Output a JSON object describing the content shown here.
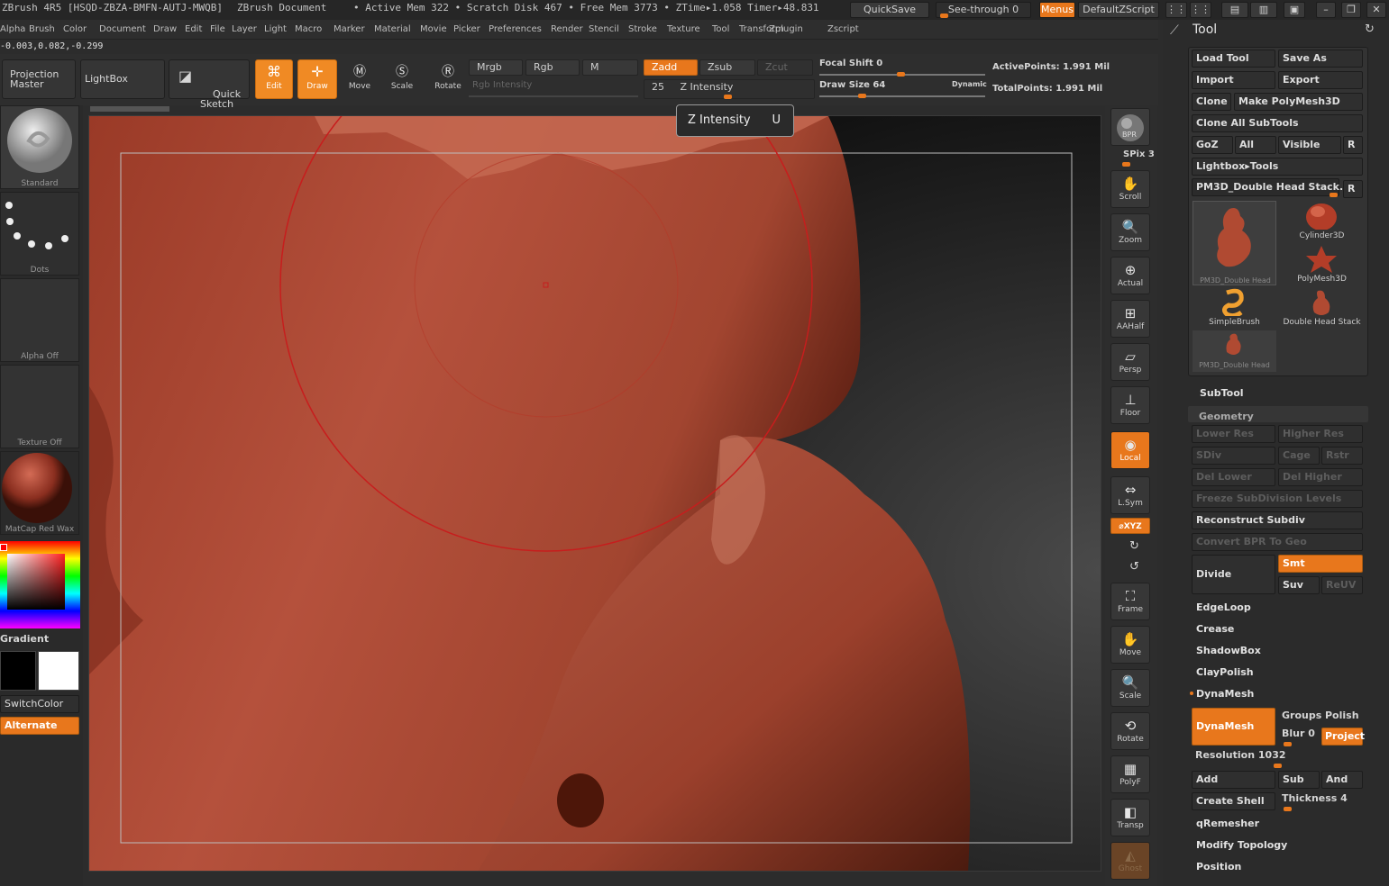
{
  "titlebar": {
    "app": "ZBrush 4R5 [HSQD-ZBZA-BMFN-AUTJ-MWQB]",
    "doc": "ZBrush Document",
    "stats": "• Active Mem 322 • Scratch Disk 467 • Free Mem 3773 • ZTime▸1.058 Timer▸48.831",
    "quicksave": "QuickSave",
    "seethrough": "See-through  0",
    "menus": "Menus",
    "script": "DefaultZScript"
  },
  "menubar": [
    "Alpha",
    "Brush",
    "Color",
    "Document",
    "Draw",
    "Edit",
    "File",
    "Layer",
    "Light",
    "Macro",
    "Marker",
    "Material",
    "Movie",
    "Picker",
    "Preferences",
    "Render",
    "Stencil",
    "Stroke",
    "Texture",
    "Tool",
    "Transform",
    "Zplugin",
    "Zscript"
  ],
  "coords": "-0.003,0.082,-0.299",
  "toolbar": {
    "projection_master": "Projection\nMaster",
    "lightbox": "LightBox",
    "quick_sketch": "Quick\nSketch",
    "edit": "Edit",
    "draw": "Draw",
    "move": "Move",
    "scale": "Scale",
    "rotate": "Rotate",
    "mrgb": "Mrgb",
    "rgb": "Rgb",
    "m": "M",
    "rgb_intensity": "Rgb Intensity",
    "zadd": "Zadd",
    "zsub": "Zsub",
    "zcut": "Zcut",
    "z_intensity_value": "25",
    "z_intensity": "Z Intensity",
    "focal_shift": "Focal Shift 0",
    "draw_size": "Draw Size 64",
    "dynamic": "Dynamic",
    "active_points": "ActivePoints: 1.991  Mil",
    "total_points": "TotalPoints: 1.991  Mil"
  },
  "tooltip": {
    "label": "Z Intensity",
    "key": "U"
  },
  "leftshelf": {
    "brush": "Standard",
    "stroke": "Dots",
    "alpha": "Alpha  Off",
    "texture": "Texture  Off",
    "material": "MatCap  Red  Wax",
    "gradient": "Gradient",
    "switchcolor": "SwitchColor",
    "alternate": "Alternate"
  },
  "rightshelf": {
    "bpr": "BPR",
    "spix": "SPix 3",
    "scroll": "Scroll",
    "zoom": "Zoom",
    "actual": "Actual",
    "aahalf": "AAHalf",
    "persp": "Persp",
    "floor": "Floor",
    "local": "Local",
    "lsym": "L.Sym",
    "xyz": "⌀XYZ",
    "frame": "Frame",
    "move": "Move",
    "scale": "Scale",
    "rotate": "Rotate",
    "polyf": "PolyF",
    "transp": "Transp",
    "ghost": "Ghost"
  },
  "panel": {
    "title": "Tool",
    "load_tool": "Load Tool",
    "save_as": "Save As",
    "import": "Import",
    "export": "Export",
    "clone": "Clone",
    "make_polymesh": "Make PolyMesh3D",
    "clone_all": "Clone All SubTools",
    "goz": "GoZ",
    "all": "All",
    "visible": "Visible",
    "r": "R",
    "lightbox_tools": "Lightbox▸Tools",
    "current_tool": "PM3D_Double Head Stack.",
    "tools": [
      {
        "name": "PM3D_Double Head"
      },
      {
        "name": "Cylinder3D"
      },
      {
        "name": "PolyMesh3D"
      },
      {
        "name": "SimpleBrush"
      },
      {
        "name": "Double Head Stack"
      },
      {
        "name": "PM3D_Double Head"
      }
    ],
    "subtool": "SubTool",
    "geometry": "Geometry",
    "lower_res": "Lower Res",
    "higher_res": "Higher Res",
    "sdiv": "SDiv",
    "cage": "Cage",
    "rstr": "Rstr",
    "del_lower": "Del Lower",
    "del_higher": "Del Higher",
    "freeze": "Freeze SubDivision Levels",
    "reconstruct": "Reconstruct Subdiv",
    "convert_bpr": "Convert BPR To Geo",
    "divide": "Divide",
    "smt": "Smt",
    "suv": "Suv",
    "reuv": "ReUV",
    "edgeloop": "EdgeLoop",
    "crease": "Crease",
    "shadowbox": "ShadowBox",
    "claypolish": "ClayPolish",
    "dynamesh_header": "DynaMesh",
    "dynamesh": "DynaMesh",
    "groups": "Groups",
    "polish": "Polish",
    "blur": "Blur 0",
    "project": "Project",
    "resolution": "Resolution 1032",
    "add": "Add",
    "sub": "Sub",
    "and": "And",
    "create_shell": "Create Shell",
    "thickness": "Thickness 4",
    "qremesher": "qRemesher",
    "modify_topology": "Modify Topology",
    "position": "Position"
  },
  "colors": {
    "accent": "#e8771c",
    "clay": "#a84832"
  }
}
